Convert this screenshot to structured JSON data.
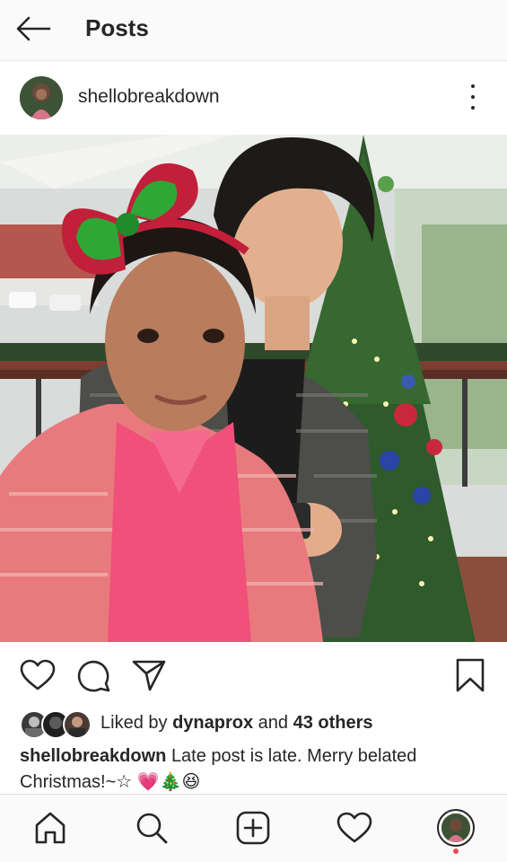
{
  "header": {
    "title": "Posts",
    "back_icon": "arrow-left-icon"
  },
  "post": {
    "username": "shellobreakdown",
    "more_icon": "more-vertical-icon",
    "photo_description_icon": "photo"
  },
  "actions": {
    "like_icon": "heart-icon",
    "comment_icon": "comment-icon",
    "share_icon": "send-icon",
    "save_icon": "bookmark-icon"
  },
  "likes": {
    "prefix": "Liked by",
    "user": "dynaprox",
    "connector": "and",
    "others": "43 others"
  },
  "caption": {
    "username": "shellobreakdown",
    "text": "Late post is late. Merry belated Christmas!~☆",
    "emojis": "💗🎄😆"
  },
  "bottom_nav": {
    "home_icon": "home-icon",
    "search_icon": "search-icon",
    "new_post_icon": "plus-square-icon",
    "activity_icon": "heart-icon",
    "profile_icon": "profile-avatar"
  },
  "colors": {
    "text": "#262626",
    "notification": "#ed4956",
    "bar_background": "#fafafa"
  }
}
